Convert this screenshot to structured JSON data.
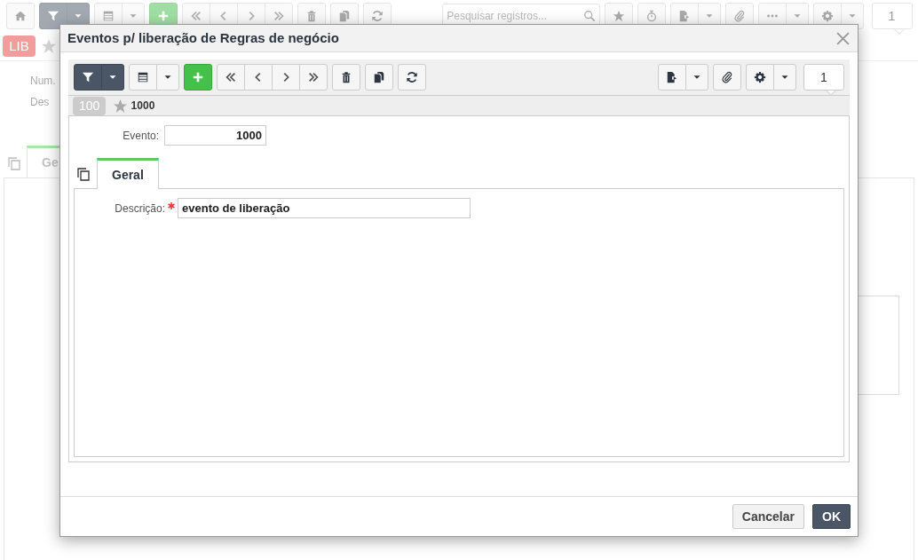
{
  "background_page": {
    "search": {
      "placeholder": "Pesquisar registros..."
    },
    "record_number": "1",
    "badge": "LIB",
    "fields": [
      {
        "label": "Num."
      },
      {
        "label": "Des"
      }
    ],
    "tabs": [
      {
        "label": "Ge",
        "selected": true
      }
    ]
  },
  "modal": {
    "title": "Eventos p/ liberação de Regras de negócio",
    "record_number": "1",
    "record": {
      "badge": "100",
      "code": "1000"
    },
    "fields": [
      {
        "label": "Evento:",
        "value": "1000"
      }
    ],
    "tabs": [
      {
        "label": "Geral",
        "selected": true
      }
    ],
    "tab_fields": [
      {
        "label": "Descrição:",
        "required": true,
        "value": "evento de liberação"
      }
    ],
    "buttons": [
      {
        "label": "Cancelar",
        "kind": "secondary"
      },
      {
        "label": "OK",
        "kind": "primary"
      }
    ]
  }
}
